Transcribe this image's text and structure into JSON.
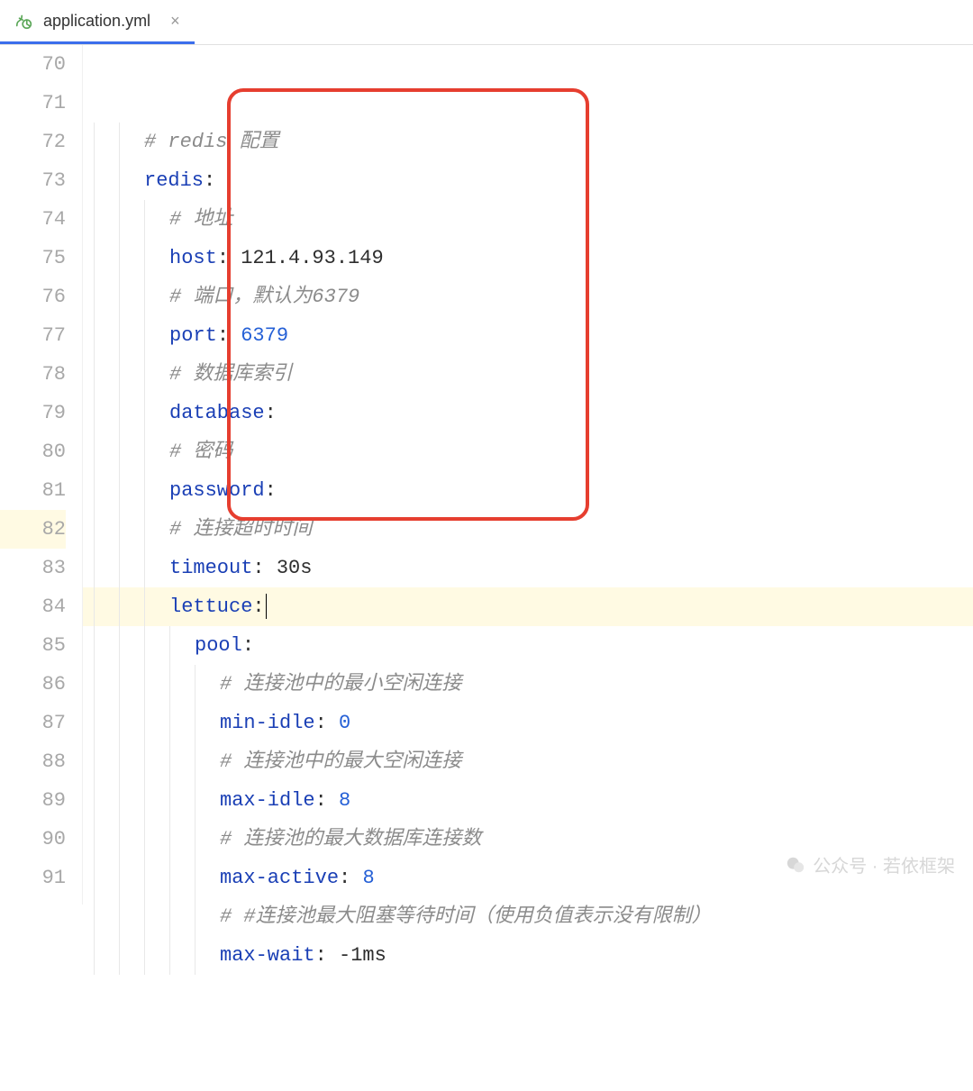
{
  "tab": {
    "filename": "application.yml",
    "close_glyph": "×"
  },
  "gutter_start": 70,
  "lines": [
    {
      "n": 70,
      "indent": 2,
      "tokens": [
        {
          "t": "comment",
          "v": "# redis 配置"
        }
      ]
    },
    {
      "n": 71,
      "indent": 2,
      "tokens": [
        {
          "t": "key",
          "v": "redis"
        },
        {
          "t": "colon",
          "v": ":"
        }
      ]
    },
    {
      "n": 72,
      "indent": 3,
      "tokens": [
        {
          "t": "comment",
          "v": "# 地址"
        }
      ]
    },
    {
      "n": 73,
      "indent": 3,
      "tokens": [
        {
          "t": "key",
          "v": "host"
        },
        {
          "t": "colon",
          "v": ": "
        },
        {
          "t": "text",
          "v": "121.4.93.149"
        }
      ]
    },
    {
      "n": 74,
      "indent": 3,
      "tokens": [
        {
          "t": "comment",
          "v": "# 端口，默认为6379"
        }
      ]
    },
    {
      "n": 75,
      "indent": 3,
      "tokens": [
        {
          "t": "key",
          "v": "port"
        },
        {
          "t": "colon",
          "v": ": "
        },
        {
          "t": "number",
          "v": "6379"
        }
      ]
    },
    {
      "n": 76,
      "indent": 3,
      "tokens": [
        {
          "t": "comment",
          "v": "# 数据库索引"
        }
      ]
    },
    {
      "n": 77,
      "indent": 3,
      "tokens": [
        {
          "t": "key",
          "v": "database"
        },
        {
          "t": "colon",
          "v": ":"
        }
      ]
    },
    {
      "n": 78,
      "indent": 3,
      "tokens": [
        {
          "t": "comment",
          "v": "# 密码"
        }
      ]
    },
    {
      "n": 79,
      "indent": 3,
      "tokens": [
        {
          "t": "key",
          "v": "password"
        },
        {
          "t": "colon",
          "v": ":"
        }
      ]
    },
    {
      "n": 80,
      "indent": 3,
      "tokens": [
        {
          "t": "comment",
          "v": "# 连接超时时间"
        }
      ]
    },
    {
      "n": 81,
      "indent": 3,
      "tokens": [
        {
          "t": "key",
          "v": "timeout"
        },
        {
          "t": "colon",
          "v": ": "
        },
        {
          "t": "text",
          "v": "30s"
        }
      ]
    },
    {
      "n": 82,
      "indent": 3,
      "current": true,
      "caret": true,
      "tokens": [
        {
          "t": "key",
          "v": "lettuce"
        },
        {
          "t": "colon",
          "v": ":"
        }
      ]
    },
    {
      "n": 83,
      "indent": 4,
      "tokens": [
        {
          "t": "key",
          "v": "pool"
        },
        {
          "t": "colon",
          "v": ":"
        }
      ]
    },
    {
      "n": 84,
      "indent": 5,
      "tokens": [
        {
          "t": "comment",
          "v": "# 连接池中的最小空闲连接"
        }
      ]
    },
    {
      "n": 85,
      "indent": 5,
      "tokens": [
        {
          "t": "key",
          "v": "min-idle"
        },
        {
          "t": "colon",
          "v": ": "
        },
        {
          "t": "number",
          "v": "0"
        }
      ]
    },
    {
      "n": 86,
      "indent": 5,
      "tokens": [
        {
          "t": "comment",
          "v": "# 连接池中的最大空闲连接"
        }
      ]
    },
    {
      "n": 87,
      "indent": 5,
      "tokens": [
        {
          "t": "key",
          "v": "max-idle"
        },
        {
          "t": "colon",
          "v": ": "
        },
        {
          "t": "number",
          "v": "8"
        }
      ]
    },
    {
      "n": 88,
      "indent": 5,
      "tokens": [
        {
          "t": "comment",
          "v": "# 连接池的最大数据库连接数"
        }
      ]
    },
    {
      "n": 89,
      "indent": 5,
      "tokens": [
        {
          "t": "key",
          "v": "max-active"
        },
        {
          "t": "colon",
          "v": ": "
        },
        {
          "t": "number",
          "v": "8"
        }
      ]
    },
    {
      "n": 90,
      "indent": 5,
      "tokens": [
        {
          "t": "comment",
          "v": "# #连接池最大阻塞等待时间（使用负值表示没有限制）"
        }
      ]
    },
    {
      "n": 91,
      "indent": 5,
      "tokens": [
        {
          "t": "key",
          "v": "max-wait"
        },
        {
          "t": "colon",
          "v": ": "
        },
        {
          "t": "text",
          "v": "-1ms"
        }
      ]
    }
  ],
  "watermark": {
    "text": "公众号 · 若依框架"
  }
}
